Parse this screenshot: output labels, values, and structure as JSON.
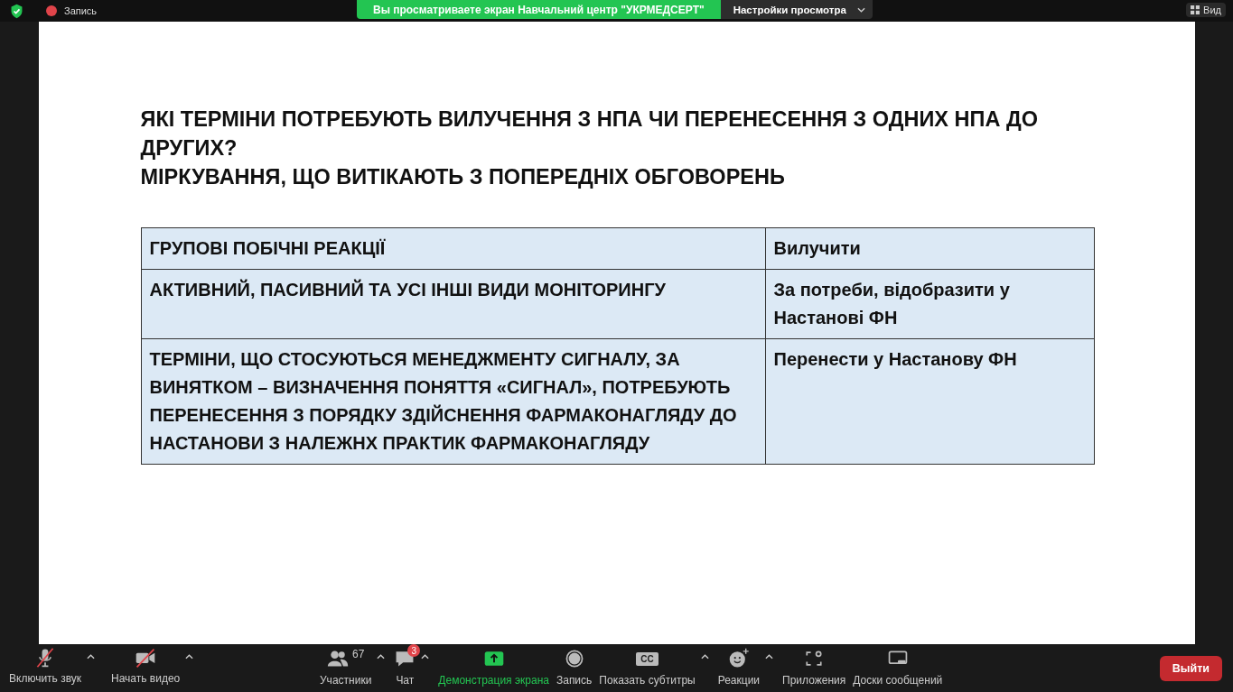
{
  "top_bar": {
    "record_label": "Запись",
    "share_banner": "Вы просматриваете экран Навчальний центр \"УКРМЕДСЕРТ\"",
    "view_options": "Настройки просмотра",
    "view_button": "Вид"
  },
  "slide": {
    "title_lines": [
      "ЯКІ ТЕРМІНИ ПОТРЕБУЮТЬ ВИЛУЧЕННЯ З НПА ЧИ ПЕРЕНЕСЕННЯ З ОДНИХ НПА ДО ДРУГИХ?",
      "МІРКУВАННЯ, ЩО ВИТІКАЮТЬ З ПОПЕРЕДНІХ ОБГОВОРЕНЬ"
    ],
    "table": {
      "rows": [
        [
          "ГРУПОВІ ПОБІЧНІ РЕАКЦІЇ",
          "Вилучити"
        ],
        [
          "АКТИВНИЙ, ПАСИВНИЙ ТА УСІ ІНШІ ВИДИ МОНІТОРИНГУ",
          "За потреби, відобразити у Настанові ФН"
        ],
        [
          "ТЕРМІНИ, ЩО СТОСУЮТЬСЯ МЕНЕДЖМЕНТУ СИГНАЛУ, ЗА ВИНЯТКОМ – ВИЗНАЧЕННЯ ПОНЯТТЯ «СИГНАЛ», ПОТРЕБУЮТЬ ПЕРЕНЕСЕННЯ З ПОРЯДКУ ЗДІЙСНЕННЯ ФАРМАКОНАГЛЯДУ ДО НАСТАНОВИ З НАЛЕЖНХ ПРАКТИК ФАРМАКОНАГЛЯДУ",
          "Перенести у Настанову ФН"
        ]
      ]
    }
  },
  "toolbar": {
    "left": [
      {
        "kind": "mic",
        "label": "Включить звук",
        "off": true,
        "caret": true
      },
      {
        "kind": "video",
        "label": "Начать видео",
        "off": true,
        "caret": true
      }
    ],
    "center": [
      {
        "kind": "participants",
        "label": "Участники",
        "count": "67",
        "caret": true
      },
      {
        "kind": "chat",
        "label": "Чат",
        "badge": "3",
        "caret": true
      },
      {
        "kind": "share",
        "label": "Демонстрация экрана",
        "highlighted": true,
        "caret": false
      },
      {
        "kind": "record",
        "label": "Запись",
        "caret": false
      },
      {
        "kind": "captions",
        "label": "Показать субтитры",
        "icon_text": "CC",
        "caret": true
      },
      {
        "kind": "reactions",
        "label": "Реакции",
        "caret": true
      },
      {
        "kind": "apps",
        "label": "Приложения",
        "caret": false
      },
      {
        "kind": "whiteboards",
        "label": "Доски сообщений",
        "caret": false
      }
    ],
    "leave_button": "Выйти"
  }
}
